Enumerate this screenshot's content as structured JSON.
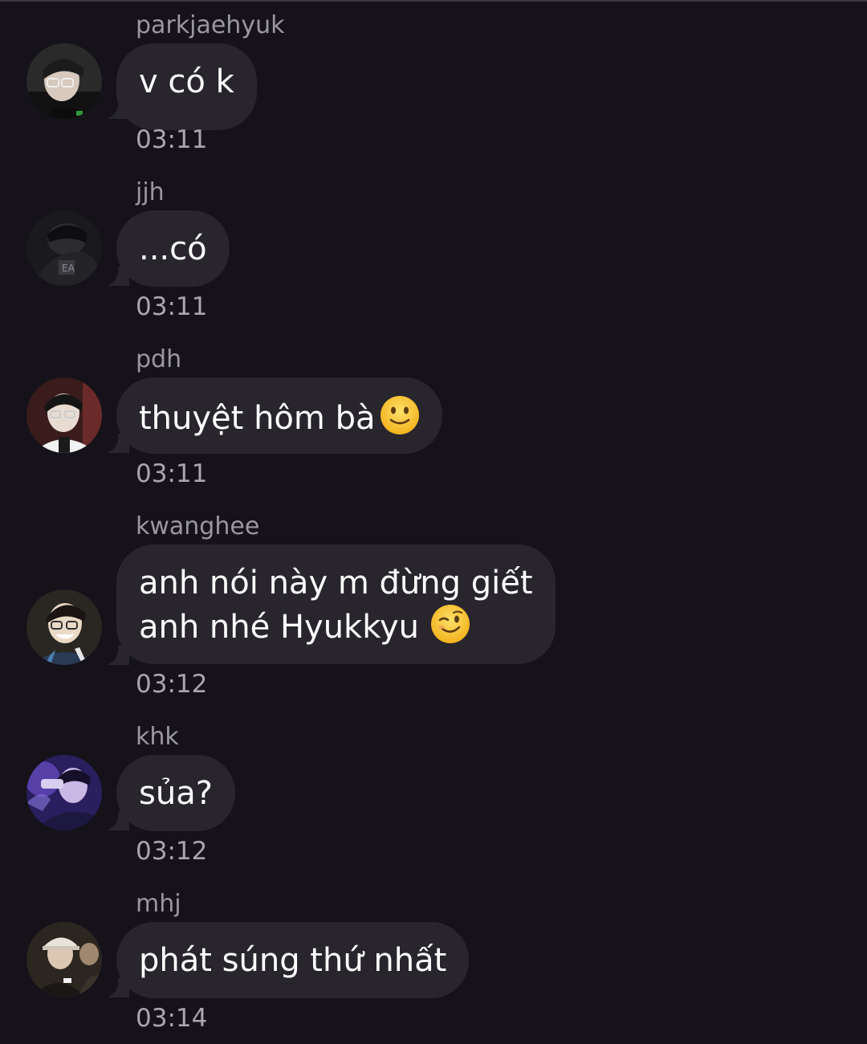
{
  "messages": [
    {
      "sender": "parkjaehyuk",
      "lines": [
        "v có k"
      ],
      "time": "03:11",
      "avatar_icon": "avatar-photo-glasses"
    },
    {
      "sender": "jjh",
      "lines": [
        "...có"
      ],
      "time": "03:11",
      "avatar_icon": "avatar-photo-dark"
    },
    {
      "sender": "pdh",
      "lines": [
        "thuyệt hôm bà"
      ],
      "emoji": "slightly-smiling-face-emoji",
      "time": "03:11",
      "avatar_icon": "avatar-photo-white-shirt"
    },
    {
      "sender": "kwanghee",
      "lines": [
        "anh nói này m đừng giết",
        "anh nhé Hyukkyu"
      ],
      "emoji": "winking-face-emoji",
      "time": "03:12",
      "avatar_icon": "avatar-photo-smiling"
    },
    {
      "sender": "khk",
      "lines": [
        "sủa?"
      ],
      "time": "03:12",
      "avatar_icon": "avatar-photo-purple"
    },
    {
      "sender": "mhj",
      "lines": [
        "phát súng thứ nhất"
      ],
      "time": "03:14",
      "avatar_icon": "avatar-photo-cap"
    }
  ],
  "colors": {
    "background": "#15121a",
    "bubble": "#28262c",
    "sender_text": "#9a979f",
    "time_text": "#a9a6ad",
    "message_text": "#ffffff",
    "emoji_yellow": "#f7c531"
  }
}
